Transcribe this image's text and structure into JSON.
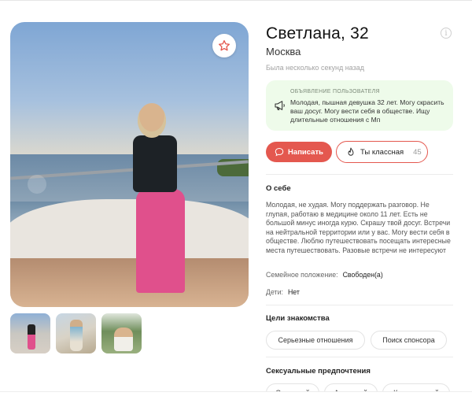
{
  "profile": {
    "name_age": "Светлана, 32",
    "city": "Москва",
    "last_seen": "Была несколько секунд назад"
  },
  "announcement": {
    "title": "ОБЪЯВЛЕНИЕ ПОЛЬЗОВАТЕЛЯ",
    "text": "Молодая, пышная девушка 32 лет. Могу скрасить ваш досуг. Могу вести себя в обществе. Ищу длительные отношения с Мп"
  },
  "actions": {
    "write_label": "Написать",
    "like_label": "Ты классная",
    "like_count": "45"
  },
  "about": {
    "title": "О себе",
    "text": "Молодая, не худая. Могу поддержать разговор. Не глупая, работаю в медицине около 11 лет. Есть не большой минус иногда курю. Скрашу твой досуг. Встречи на нейтральной территории или у вас. Могу вести себя в обществе. Люблю путешествовать посещать интересные места путешествовать. Разовые встречи не интересуют",
    "marital_label": "Семейное положение:",
    "marital_value": "Свободен(а)",
    "kids_label": "Дети:",
    "kids_value": "Нет"
  },
  "goals": {
    "title": "Цели знакомства",
    "chips": [
      "Серьезные отношения",
      "Поиск спонсора"
    ]
  },
  "preferences": {
    "title": "Сексуальные предпочтения",
    "chips": [
      "Оральный",
      "Анальный",
      "Классический"
    ]
  },
  "icons": {
    "favorite": "star-icon",
    "info": "info-icon",
    "announcement": "megaphone-icon",
    "message": "chat-bubble-icon",
    "like": "flame-icon"
  },
  "colors": {
    "accent": "#e4584f",
    "announcement_bg": "#eefbea"
  }
}
